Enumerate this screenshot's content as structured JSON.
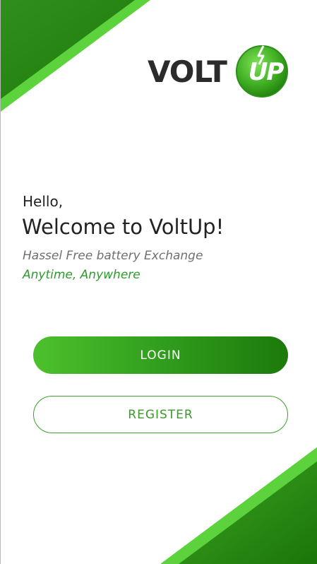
{
  "brand": {
    "logo_text": "VOLT",
    "logo_badge_text": "UP",
    "accent": "#3aa02a",
    "accent_dark": "#1c7a0a",
    "accent_light": "#5cd33c"
  },
  "welcome": {
    "greeting": "Hello,",
    "title": "Welcome to VoltUp!",
    "tagline": "Hassel Free battery Exchange",
    "tagline_highlight": "Anytime, Anywhere"
  },
  "actions": {
    "login_label": "LOGIN",
    "register_label": "REGISTER"
  }
}
